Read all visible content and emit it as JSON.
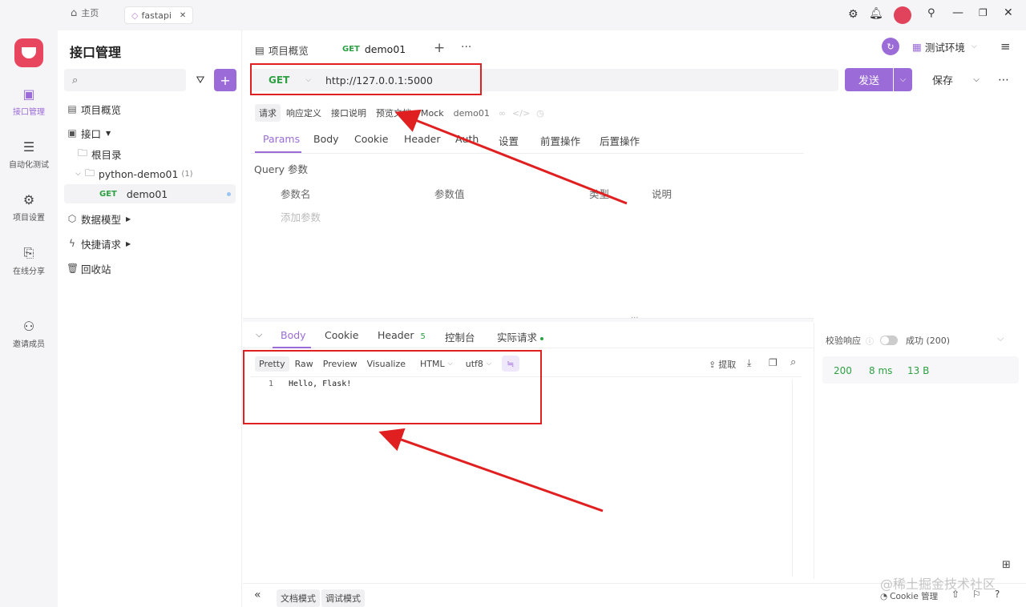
{
  "topbar": {
    "home_label": "主页",
    "tab_label": "fastapi",
    "close_glyph": "✕"
  },
  "rail": {
    "items": [
      {
        "label": "接口管理",
        "icon": "api-icon"
      },
      {
        "label": "自动化测试",
        "icon": "automation-icon"
      },
      {
        "label": "项目设置",
        "icon": "project-settings-icon"
      },
      {
        "label": "在线分享",
        "icon": "share-icon"
      },
      {
        "label": "邀请成员",
        "icon": "invite-user-icon"
      }
    ]
  },
  "tree": {
    "title": "接口管理",
    "items": [
      {
        "label": "项目概览"
      },
      {
        "label": "接口"
      },
      {
        "label": "根目录"
      },
      {
        "label": "python-demo01",
        "count": "(1)"
      },
      {
        "method": "GET",
        "label": "demo01"
      },
      {
        "label": "数据模型"
      },
      {
        "label": "快捷请求"
      },
      {
        "label": "回收站"
      }
    ]
  },
  "tabs": {
    "overview_label": "项目概览",
    "active_method": "GET",
    "active_label": "demo01",
    "add": "+",
    "more": "···"
  },
  "env": {
    "label": "测试环境"
  },
  "request": {
    "method": "GET",
    "url": "http://127.0.0.1:5000",
    "send_label": "发送",
    "save_label": "保存"
  },
  "chips": [
    "请求",
    "响应定义",
    "接口说明",
    "预览文档",
    "Mock",
    "demo01"
  ],
  "param_tabs": [
    "Params",
    "Body",
    "Cookie",
    "Header",
    "Auth",
    "设置",
    "前置操作",
    "后置操作"
  ],
  "query": {
    "title": "Query 参数",
    "columns": [
      "参数名",
      "参数值",
      "类型",
      "说明"
    ],
    "add_placeholder": "添加参数"
  },
  "response": {
    "tabs": [
      {
        "label": "Body"
      },
      {
        "label": "Cookie"
      },
      {
        "label": "Header",
        "badge": "5"
      },
      {
        "label": "控制台"
      },
      {
        "label": "实际请求"
      }
    ],
    "formats": [
      "Pretty",
      "Raw",
      "Preview",
      "Visualize"
    ],
    "format_select": "HTML",
    "encoding": "utf8",
    "extract_label": "提取",
    "line_number": "1",
    "body_text": "Hello, Flask!",
    "validate_label": "校验响应",
    "success_label": "成功 (200)",
    "status": "200",
    "time": "8 ms",
    "size": "13 B"
  },
  "footer": {
    "doc_mode": "文档模式",
    "debug_mode": "调试模式",
    "cookie_label": "Cookie 管理",
    "watermark": "@稀土掘金技术社区"
  },
  "colors": {
    "accent": "#9b6bd8",
    "get": "#2ea043",
    "annotation": "#e02020"
  }
}
